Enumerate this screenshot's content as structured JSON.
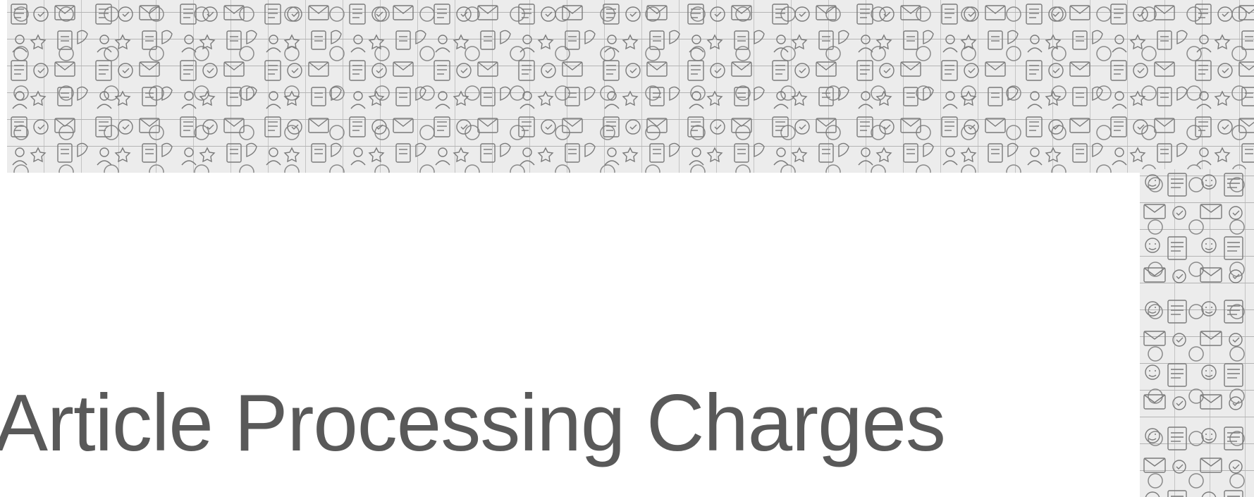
{
  "slide": {
    "title": "Article Processing Charges"
  },
  "decoration": {
    "top_band_icon": "icon-doodle-pattern",
    "right_band_icon": "icon-doodle-pattern",
    "pattern_color": "#8a8a8a",
    "band_background": "#ececec"
  },
  "colors": {
    "title": "#595959",
    "background": "#ffffff"
  }
}
